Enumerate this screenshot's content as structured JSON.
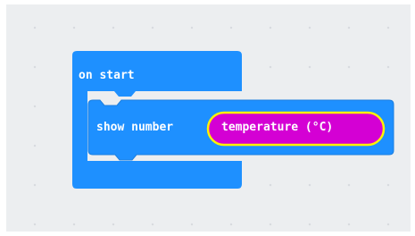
{
  "on_start_block": {
    "label": "on start",
    "color": "#1e90ff"
  },
  "show_number_block": {
    "label": "show number",
    "color": "#1e90ff"
  },
  "temperature_reporter": {
    "label": "temperature (°C)",
    "color": "#d400d4",
    "outline_color": "#fff200"
  },
  "workspace": {
    "background": "#eceef0"
  }
}
